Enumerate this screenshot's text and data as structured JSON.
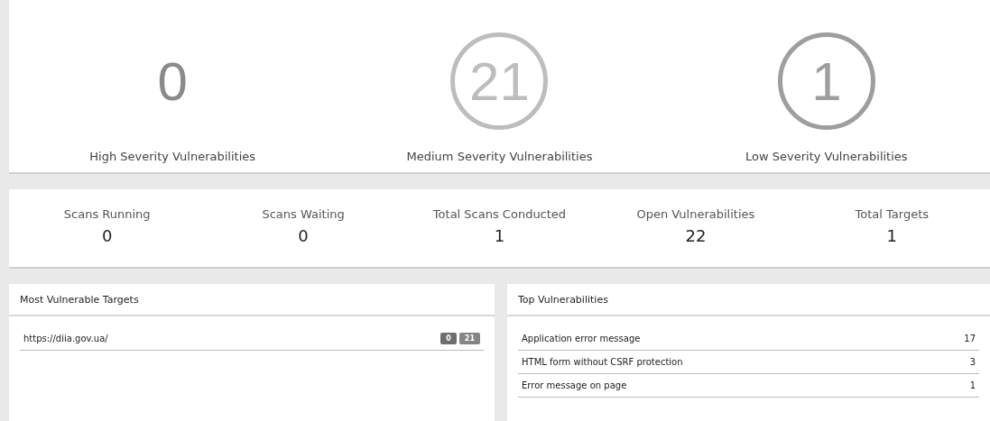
{
  "severities": [
    {
      "count": "0",
      "label": "High Severity Vulnerabilities",
      "ring": false,
      "color": "#8a8a8a"
    },
    {
      "count": "21",
      "label": "Medium Severity Vulnerabilities",
      "ring": true,
      "color": "#bdbdbd"
    },
    {
      "count": "1",
      "label": "Low Severity Vulnerabilities",
      "ring": true,
      "color": "#9e9e9e"
    }
  ],
  "stats": [
    {
      "label": "Scans Running",
      "value": "0"
    },
    {
      "label": "Scans Waiting",
      "value": "0"
    },
    {
      "label": "Total Scans Conducted",
      "value": "1"
    },
    {
      "label": "Open Vulnerabilities",
      "value": "22"
    },
    {
      "label": "Total Targets",
      "value": "1"
    }
  ],
  "targets_panel": {
    "title": "Most Vulnerable Targets",
    "rows": [
      {
        "url": "https://diia.gov.ua/",
        "badges": [
          {
            "text": "0",
            "color": "#6e6e6e"
          },
          {
            "text": "21",
            "color": "#858585"
          }
        ]
      }
    ]
  },
  "vulns_panel": {
    "title": "Top Vulnerabilities",
    "rows": [
      {
        "name": "Application error message",
        "count": "17"
      },
      {
        "name": "HTML form without CSRF protection",
        "count": "3"
      },
      {
        "name": "Error message on page",
        "count": "1"
      }
    ]
  }
}
